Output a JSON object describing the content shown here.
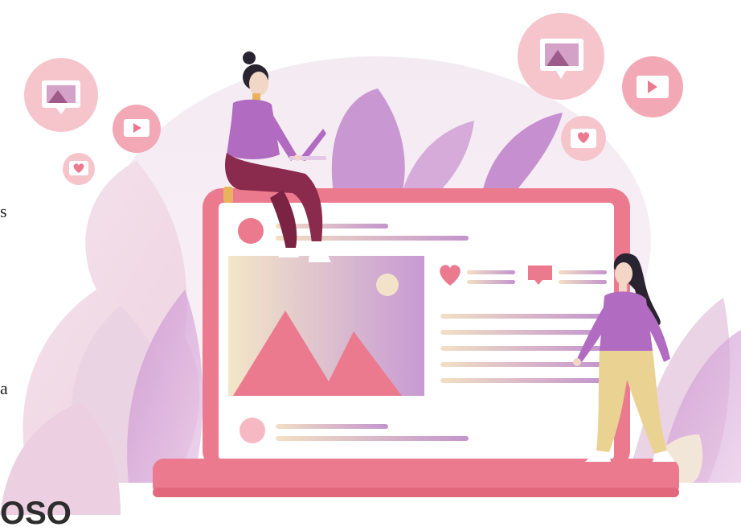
{
  "edge_text": {
    "line1": "s",
    "line2": "a",
    "bottom": "OSO"
  },
  "colors": {
    "pink": "#ec7a8e",
    "soft_pink": "#f6b9c3",
    "purple": "#b16bc1",
    "lavender": "#d9b8e0",
    "maroon": "#8a2a4c",
    "cream": "#f2e2c8",
    "yellow_pants": "#ead392"
  },
  "icons": [
    "image-bubble-icon",
    "play-bubble-icon",
    "heart-bubble-icon",
    "heart-icon",
    "comment-icon",
    "mountain-image-icon"
  ]
}
